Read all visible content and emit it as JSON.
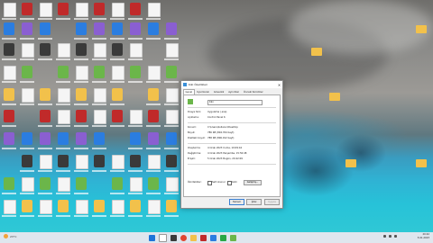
{
  "dialog": {
    "title": "Kiki Özellikleri",
    "tabs": [
      "Genel",
      "Uyumluluk",
      "Güvenlik",
      "Ayrıntılar",
      "Önceki Sürümler"
    ],
    "active_tab": 0,
    "file_name": "Kiki",
    "props": {
      "type_label": "Dosya türü:",
      "type_value": "Uygulama (.exe)",
      "opens_label": "Açıklama:",
      "opens_value": "Control Panel 6",
      "location_label": "Konum:",
      "location_value": "C:\\Users\\kullanıcı\\Desktop",
      "size_label": "Boyut:",
      "size_value": "786 KB (804.764 bayt)",
      "disk_label": "Diskteki boyut:",
      "disk_value": "788 KB (806.912 bayt)",
      "created_label": "Oluşturma:",
      "created_value": "4 Ocak 2023 Cuma, 19:09:16",
      "modified_label": "Değiştirme:",
      "modified_value": "4 Ocak 2023 Perşembe, 15:50:48",
      "accessed_label": "Erişim:",
      "accessed_value": "5 Ocak 2023 Bugün, 20:42:09",
      "attrs_label": "Öznitelikler:",
      "readonly_label": "Salt okunur",
      "hidden_label": "Gizli",
      "advanced_button": "Gelişmiş..."
    },
    "buttons": {
      "ok": "Tamam",
      "cancel": "İptal",
      "apply": "Uygula"
    }
  },
  "taskbar": {
    "weather_temp": "23°C",
    "weather_text": "Az bulutlu",
    "time": "20:42",
    "date": "5.01.2023"
  }
}
